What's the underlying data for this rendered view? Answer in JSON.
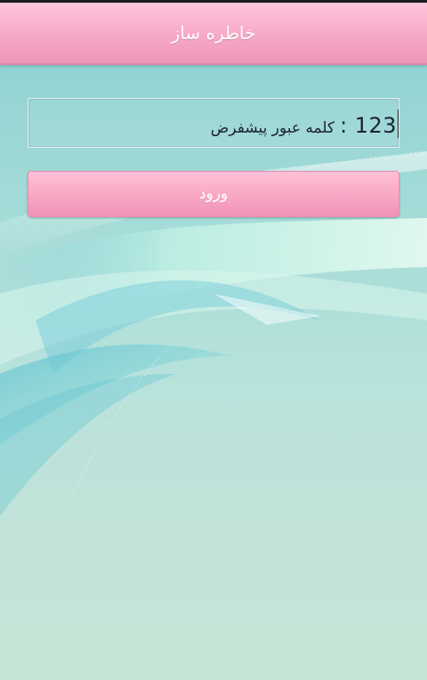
{
  "titlebar": {
    "title": "خاطره ساز"
  },
  "password_field": {
    "value": "123",
    "separator": ":",
    "hint": "کلمه عبور پیشفرض"
  },
  "login_button": {
    "label": "ورود"
  },
  "colors": {
    "titlebar": "#f7a8c6",
    "button": "#f8a7c4",
    "background": "#a9dcd8"
  }
}
